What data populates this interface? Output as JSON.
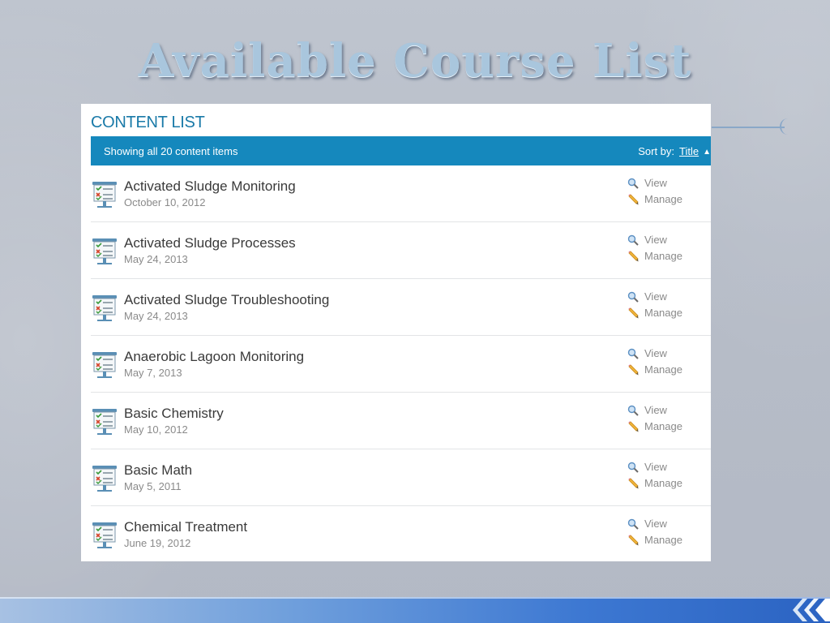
{
  "slide": {
    "title": "Available Course List"
  },
  "content_list": {
    "heading": "CONTENT LIST",
    "summary": "Showing all 20 content items",
    "sort_label": "Sort by:",
    "sort_field": "Title",
    "sort_arrow": "▲",
    "items": [
      {
        "title": "Activated Sludge Monitoring",
        "date": "October 10, 2012",
        "view": "View",
        "manage": "Manage"
      },
      {
        "title": "Activated Sludge Processes",
        "date": "May 24, 2013",
        "view": "View",
        "manage": "Manage"
      },
      {
        "title": "Activated Sludge Troubleshooting",
        "date": "May 24, 2013",
        "view": "View",
        "manage": "Manage"
      },
      {
        "title": "Anaerobic Lagoon Monitoring",
        "date": "May 7, 2013",
        "view": "View",
        "manage": "Manage"
      },
      {
        "title": "Basic Chemistry",
        "date": "May 10, 2012",
        "view": "View",
        "manage": "Manage"
      },
      {
        "title": "Basic Math",
        "date": "May 5, 2011",
        "view": "View",
        "manage": "Manage"
      },
      {
        "title": "Chemical Treatment",
        "date": "June 19, 2012",
        "view": "View",
        "manage": "Manage"
      }
    ]
  },
  "icons": {
    "course": "presentation-checklist-icon",
    "view": "magnifier-icon",
    "manage": "pencil-icon"
  },
  "colors": {
    "accent": "#1588bd",
    "heading": "#1a7aa8",
    "title_text": "#3a3a3a",
    "muted_text": "#8a8a8a"
  }
}
